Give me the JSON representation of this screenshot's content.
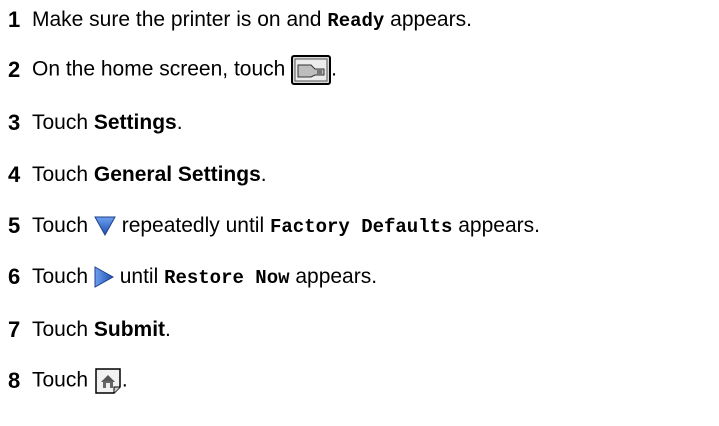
{
  "steps": [
    {
      "number": "1",
      "a": "Make sure the printer is on and ",
      "code": "Ready",
      "b": " appears."
    },
    {
      "number": "2",
      "a": "On the home screen, touch ",
      "icon": "settings-menu-icon",
      "b": "."
    },
    {
      "number": "3",
      "a": "Touch ",
      "bold": "Settings",
      "b": "."
    },
    {
      "number": "4",
      "a": "Touch ",
      "bold": "General Settings",
      "b": "."
    },
    {
      "number": "5",
      "a": "Touch ",
      "icon": "down-arrow-icon",
      "b": " repeatedly until ",
      "code": "Factory Defaults",
      "c": " appears."
    },
    {
      "number": "6",
      "a": "Touch ",
      "icon": "right-arrow-icon",
      "b": " until ",
      "code": "Restore Now",
      "c": " appears."
    },
    {
      "number": "7",
      "a": "Touch ",
      "bold": "Submit",
      "b": "."
    },
    {
      "number": "8",
      "a": "Touch ",
      "icon": "home-icon",
      "b": "."
    }
  ],
  "colors": {
    "arrow_blue": "#2a62c9",
    "icon_border": "#000000"
  }
}
